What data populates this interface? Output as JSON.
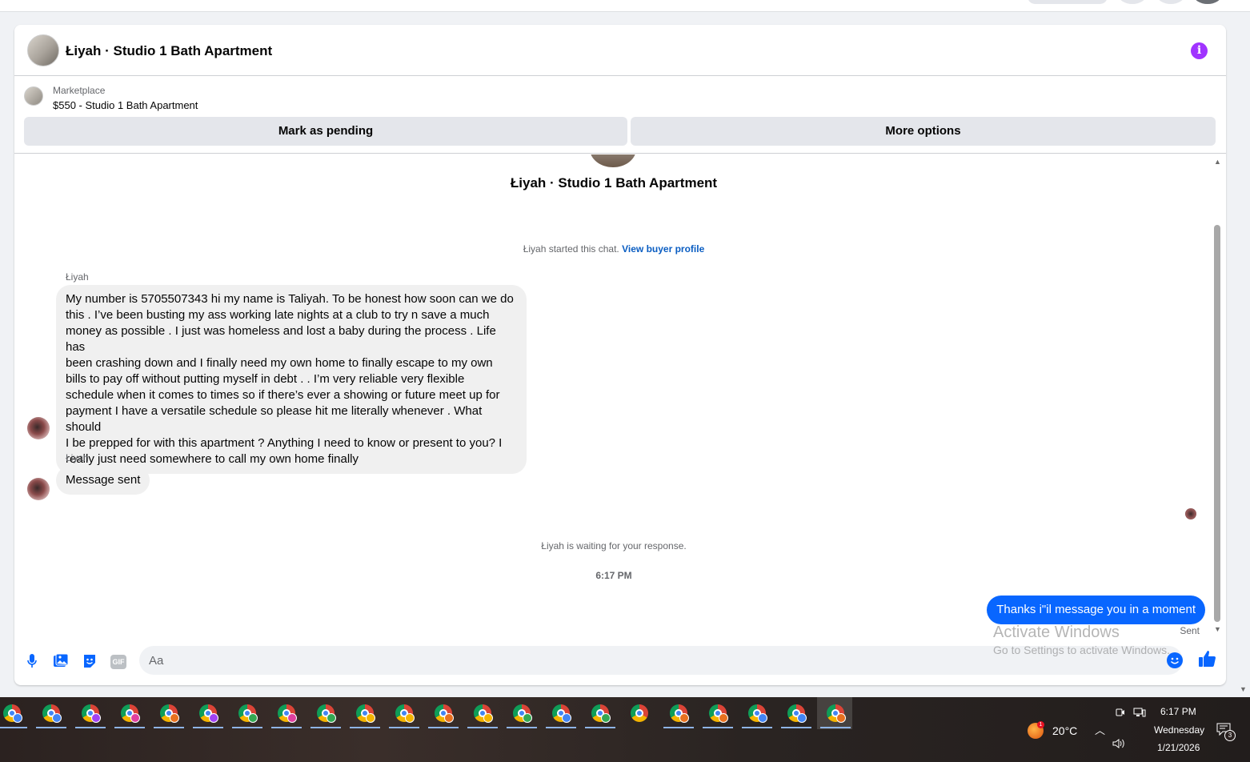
{
  "chat": {
    "title": "Łiyah · Studio 1 Bath Apartment",
    "info_icon": "info-icon",
    "info_glyph": "i"
  },
  "marketplace": {
    "label": "Marketplace",
    "listing": "$550 - Studio 1 Bath Apartment",
    "buttons": {
      "pending": "Mark as pending",
      "more": "More options"
    }
  },
  "thread": {
    "title": "Łiyah · Studio 1 Bath Apartment",
    "started_text": "Łiyah started this chat.",
    "view_profile": "View buyer profile",
    "messages": [
      {
        "sender": "Łiyah",
        "lines": [
          "My number is 5705507343 hi my name is Taliyah. To be honest how soon can we do",
          "this . I’ve been busting my ass working late nights at a club to try n save a much",
          "money as possible . I just was homeless and lost a baby during the process . Life has",
          "been crashing down and I finally need my own home to finally escape to my own",
          "bills to pay off without putting myself in debt .  . I’m very reliable very flexible",
          "schedule when it comes to times so if there’s ever a showing or future meet up for",
          "payment I have a versatile schedule so please hit me literally whenever . What should",
          "I be prepped for with this apartment ? Anything I need to know or present to you? I",
          "really just need somewhere to call my own home finally"
        ]
      },
      {
        "sender": "Łiyah",
        "text": "Message sent"
      }
    ],
    "waiting_text": "Łiyah is waiting for your response.",
    "timestamp": "6:17 PM",
    "outgoing": "Thanks i\"il message you in a moment",
    "outgoing_status": "Sent"
  },
  "composer": {
    "placeholder": "Aa",
    "gif_label": "GIF",
    "icons": [
      "microphone-icon",
      "photo-icon",
      "sticker-icon",
      "gif-icon",
      "emoji-icon",
      "thumbs-up-icon"
    ]
  },
  "watermark": {
    "line1": "Activate Windows",
    "line2": "Go to Settings to activate Windows."
  },
  "taskbar": {
    "apps_count": 21,
    "badge_colors": [
      "#4285f4",
      "#4285f4",
      "#a142f4",
      "#e040a0",
      "#e8711f",
      "#a142f4",
      "#34a853",
      "#e040a0",
      "#34a853",
      "#f4b400",
      "#f4b400",
      "#e8711f",
      "#f4b400",
      "#34a853",
      "#4285f4",
      "#34a853",
      "",
      "#e8711f",
      "#e8711f",
      "#4285f4",
      "#4285f4",
      "#e8711f"
    ],
    "weather_temp": "20°C",
    "weather_badge": "1",
    "clock_time": "6:17 PM",
    "clock_day": "Wednesday",
    "clock_date": "1/21/2026",
    "notification_count": "3"
  }
}
